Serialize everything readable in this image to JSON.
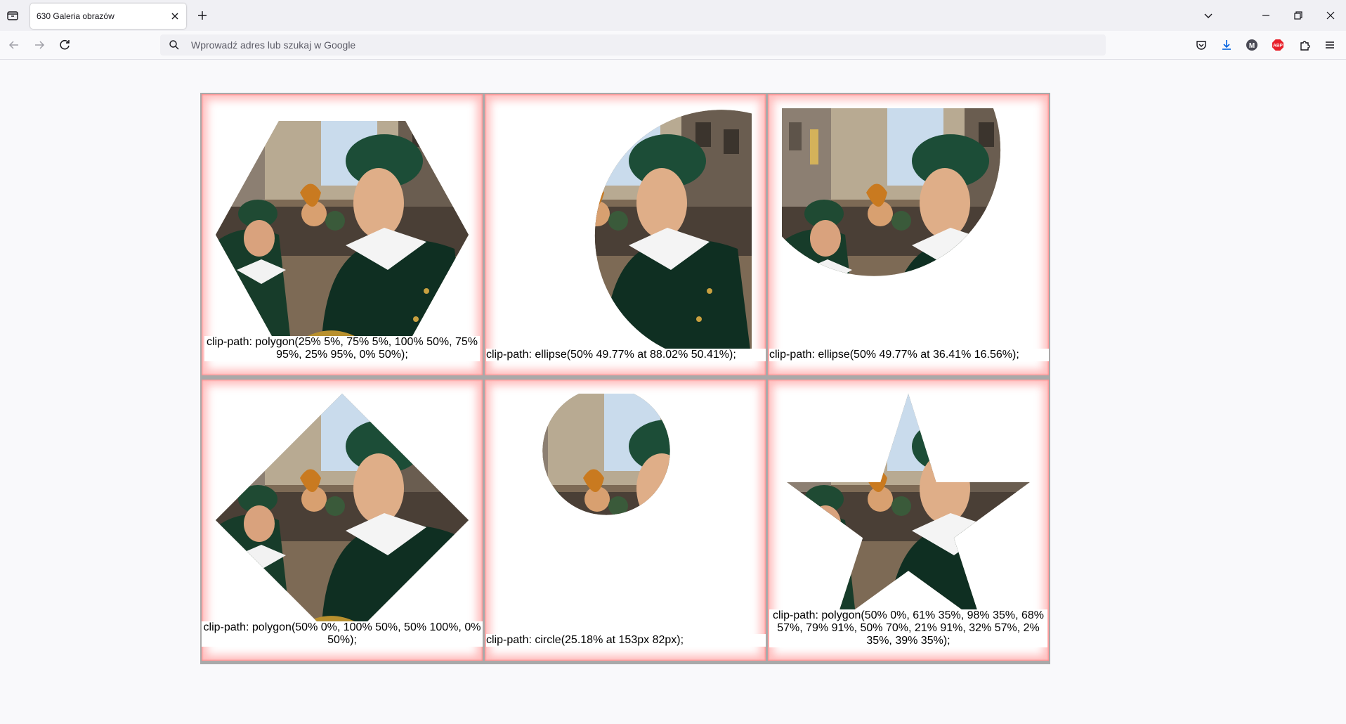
{
  "browser": {
    "tab_title": "630 Galeria obrazów",
    "address_placeholder": "Wprowadź adres lub szukaj w Google",
    "icons": [
      "tab-list-icon",
      "close-icon",
      "plus-icon",
      "chevron-down-icon",
      "minimize-icon",
      "restore-icon",
      "window-close-icon",
      "back-arrow-icon",
      "forward-arrow-icon",
      "reload-icon",
      "search-icon",
      "pocket-icon",
      "download-icon",
      "account-icon",
      "adblock-icon",
      "extensions-icon",
      "menu-icon"
    ],
    "account_letter": "M",
    "adblock_label": "ABP"
  },
  "gallery": {
    "items": [
      {
        "caption": "clip-path: polygon(25% 5%, 75% 5%, 100% 50%, 75% 95%, 25% 95%, 0% 50%);",
        "shape": "hexagon"
      },
      {
        "caption": "clip-path: ellipse(50% 49.77% at 88.02% 50.41%);",
        "shape": "ellipse-right"
      },
      {
        "caption": "clip-path: ellipse(50% 49.77% at 36.41% 16.56%);",
        "shape": "ellipse-top"
      },
      {
        "caption": "clip-path: polygon(50% 0%, 100% 50%, 50% 100%, 0% 50%);",
        "shape": "diamond"
      },
      {
        "caption": "clip-path: circle(25.18% at 153px 82px);",
        "shape": "circle"
      },
      {
        "caption": "clip-path: polygon(50% 0%, 61% 35%, 98% 35%, 68% 57%, 79% 91%, 50% 70%, 21% 91%, 32% 57%, 2% 35%, 39% 35%);",
        "shape": "star"
      }
    ]
  },
  "colors": {
    "frame_glow": "#ff8080",
    "gallery_border": "#a9a9a9"
  }
}
